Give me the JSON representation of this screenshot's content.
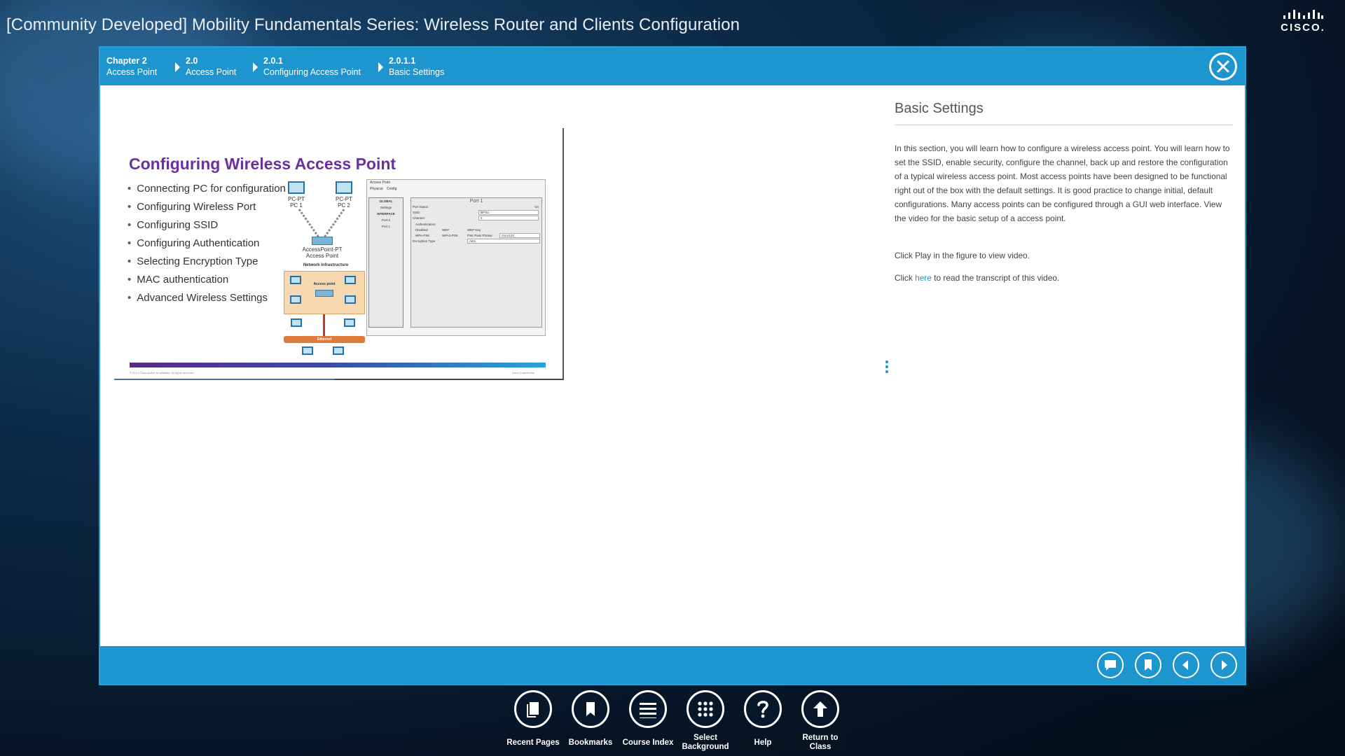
{
  "window": {
    "title": "[Community Developed] Mobility Fundamentals Series: Wireless Router and Clients Configuration",
    "brand": "CISCO."
  },
  "breadcrumb": [
    {
      "number": "Chapter 2",
      "label": "Access Point"
    },
    {
      "number": "2.0",
      "label": "Access Point"
    },
    {
      "number": "2.0.1",
      "label": "Configuring Access Point"
    },
    {
      "number": "2.0.1.1",
      "label": "Basic Settings"
    }
  ],
  "slide": {
    "title": "Configuring Wireless Access Point",
    "bullets": [
      "Connecting PC for configuration",
      "Configuring Wireless Port",
      "Configuring SSID",
      "Configuring Authentication",
      "Selecting Encryption Type",
      "MAC authentication",
      "Advanced Wireless Settings"
    ],
    "diagram": {
      "pc1": "PC-PT\nPC 1",
      "pc2": "PC-PT\nPC 2",
      "ap": "AccessPoint-PT\nAccess Point",
      "network": "Network Infrastructure",
      "access_point": "Access point",
      "ethernet": "Ethernet"
    },
    "config_window": {
      "title": "Access Point",
      "tabs": [
        "Physical",
        "Config"
      ],
      "side_items": [
        "GLOBAL",
        "Settings",
        "INTERFACE",
        "Port 0",
        "Port 1"
      ],
      "panel_title": "Port 1",
      "port_status": "Port Status",
      "port_status_value": "On",
      "ssid_label": "SSID",
      "ssid_value": "BPSU",
      "channel_label": "Channel",
      "channel_value": "6",
      "auth_label": "Authentication",
      "disabled": "Disabled",
      "wep": "WEP",
      "wep_key": "WEP Key",
      "wpa_psk": "WPA-PSK",
      "wpa2_psk": "WPA2-PSK",
      "psk_pass": "PSK Pass Phrase",
      "psk_value": "cisco123",
      "enc_label": "Encryption Type",
      "enc_value": "AES"
    },
    "footer_left": "© 2013 Cisco and/or its affiliates. All rights reserved.",
    "footer_right": "Cisco Confidential"
  },
  "right_pane": {
    "title": "Basic Settings",
    "body": "In this section, you will learn how to configure a wireless access point. You will learn how to set the SSID, enable security, configure the channel, back up and restore the configuration of a typical wireless access point. Most access points have been designed to be functional right out of the box with the default settings. It is good practice to change initial, default configurations. Many access points can be configured through a GUI web interface. View the video for the basic setup of a access point.",
    "play_text": "Click Play in the figure to view video.",
    "click": "Click",
    "link": "here",
    "link_suffix": "to read the transcript of this video."
  },
  "dock": [
    {
      "label": "Recent Pages",
      "icon": "recent-pages-icon"
    },
    {
      "label": "Bookmarks",
      "icon": "bookmark-icon"
    },
    {
      "label": "Course Index",
      "icon": "menu-icon"
    },
    {
      "label": "Select Background",
      "icon": "grid-dots-icon"
    },
    {
      "label": "Help",
      "icon": "help-icon"
    },
    {
      "label": "Return to Class",
      "icon": "arrow-up-icon"
    }
  ],
  "colors": {
    "accent": "#1d95cf",
    "slide_title": "#6b2fa0",
    "link": "#1d95cf"
  }
}
